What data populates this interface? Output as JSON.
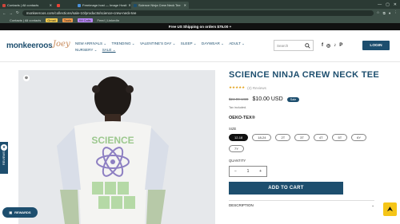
{
  "browser": {
    "tabs": [
      {
        "label": "Contacts | All contacts",
        "active": false
      },
      {
        "label": "Gmail",
        "active": false
      },
      {
        "label": "Freeimage.host — Image Hosti",
        "active": false
      },
      {
        "label": "Science Ninja Crew Neck Tee",
        "active": true
      }
    ],
    "url": "monkeeroos.com/collections/sale-10/products/science-crew-neck-tee",
    "bookmarks": [
      {
        "label": "Gmail",
        "color": "#f2c94c"
      },
      {
        "label": "Tools",
        "color": "#f2994a"
      },
      {
        "label": "IM Calls",
        "color": "#bb86fc"
      },
      {
        "label": "Feed | LinkedIn",
        "color": ""
      }
    ]
  },
  "announcement": "Free US Shipping on orders $75.00 +",
  "header": {
    "logo": "monkeeroos",
    "logo2": "Joey",
    "nav": [
      "NEW ARRIVALS ⌄",
      "TRENDING ⌄",
      "VALENTINE'S DAY ⌄",
      "SLEEP ⌄",
      "DAYWEAR ⌄",
      "ADULT ⌄",
      "NURSERY ⌄",
      "SALE ⌄"
    ],
    "search_placeholder": "Search",
    "socials": [
      "f",
      "◎",
      "♪",
      "P"
    ],
    "login_label": "LOGIN"
  },
  "product": {
    "title": "SCIENCE NINJA CREW NECK TEE",
    "stars": "★★★★★",
    "reviews": "(2) Reviews",
    "old_price": "$24.99 USD",
    "new_price": "$10.00 USD",
    "sale_badge": "Sale",
    "tax_note": "Tax included.",
    "certification": "OEKO-TEX®",
    "size_label": "SIZE",
    "sizes": [
      "12-18",
      "18-24",
      "2T",
      "3T",
      "4T",
      "5T",
      "6Y",
      "7Y"
    ],
    "selected_size": "12-18",
    "quantity_label": "QUANTITY",
    "quantity": "1",
    "add_to_cart": "ADD TO CART",
    "description_label": "DESCRIPTION"
  },
  "widgets": {
    "reviews_tab": "REVIEWS",
    "rewards": "REWARDS"
  },
  "colors": {
    "brand": "#1d4e6e",
    "accent": "#f5c518"
  }
}
